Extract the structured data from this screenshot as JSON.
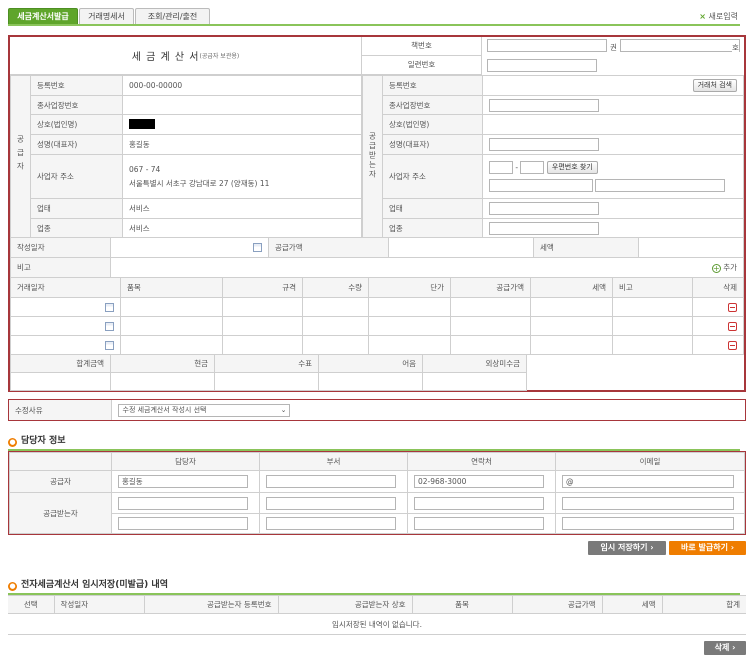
{
  "tabs": [
    {
      "label": "세금계산서발급",
      "active": true
    },
    {
      "label": "거래명세서",
      "active": false
    },
    {
      "label": "조회/관리/출전",
      "active": false
    }
  ],
  "new_input_label": "새로입력",
  "invoice": {
    "title": "세 금 계 산 서",
    "title_sub": "(공급자 보관용)",
    "book_no_label": "책번호",
    "book_unit": "권",
    "book_unit2": "호",
    "serial_label": "일련번호"
  },
  "supplier": {
    "side_label": "공급자",
    "reg_no_label": "등록번호",
    "reg_no": "000-00-00000",
    "sub_biz_label": "종사업장번호",
    "sub_biz": "",
    "name_label": "상호(법인명)",
    "rep_label": "성명(대표자)",
    "rep": "홍길동",
    "addr_label": "사업자 주소",
    "zip": "067 - 74",
    "addr": "서울특별시 서초구 강남대로 27 (양재동) 11",
    "type_label": "업태",
    "type": "서비스",
    "item_label": "업종",
    "item": "서비스"
  },
  "receiver": {
    "side_label": "공급받는자",
    "reg_no_label": "등록번호",
    "search_btn": "거래처 검색",
    "sub_biz_label": "종사업장번호",
    "name_label": "상호(법인명)",
    "rep_label": "성명(대표자)",
    "addr_label": "사업자 주소",
    "zip_btn": "우편번호 찾기",
    "type_label": "업태",
    "item_label": "업종"
  },
  "summary": {
    "date_label": "작성일자",
    "supply_label": "공급가액",
    "tax_label": "세액",
    "note_label": "비고",
    "add_label": "추가"
  },
  "items": {
    "headers": [
      "거래일자",
      "품목",
      "규격",
      "수량",
      "단가",
      "공급가액",
      "세액",
      "비고",
      "삭제"
    ],
    "rows": 3
  },
  "totals": {
    "headers": [
      "합계금액",
      "현금",
      "수표",
      "어음",
      "외상미수금"
    ]
  },
  "reason": {
    "label": "수정사유",
    "select": "수정 세금계산서 작성시 선택"
  },
  "manager": {
    "title": "담당자 정보",
    "headers": [
      "담당자",
      "부서",
      "연락처",
      "이메일"
    ],
    "supplier_label": "공급자",
    "receiver_label": "공급받는자",
    "supplier_name": "홍길동",
    "supplier_phone": "02-968-3000",
    "supplier_email": "@"
  },
  "actions": {
    "temp_save": "임시 저장하기 ›",
    "issue_now": "바로 발급하기 ›"
  },
  "history": {
    "title": "전자세금계산서 임시저장(미발급) 내역",
    "headers": [
      "선택",
      "작성일자",
      "공급받는자 등록번호",
      "공급받는자 상호",
      "품목",
      "공급가액",
      "세액",
      "합계"
    ],
    "empty": "임시저장된 내역이 없습니다.",
    "delete_btn": "삭제 ›"
  },
  "colors": {
    "green": "#5fa52b",
    "border_red": "#a7363b",
    "orange": "#ef7d00",
    "gray_btn": "#7a7a7a"
  }
}
